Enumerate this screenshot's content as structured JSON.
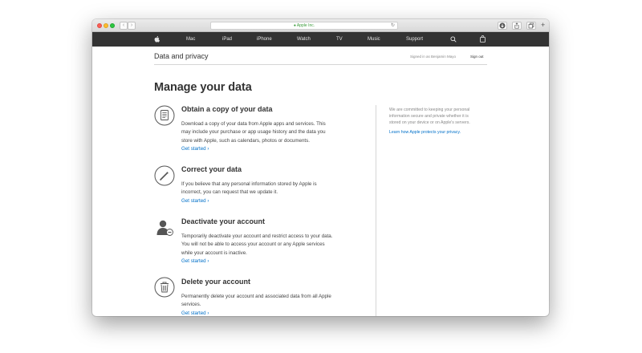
{
  "browser": {
    "url_label": "Apple Inc.",
    "back_glyph": "‹",
    "forward_glyph": "›",
    "reload_glyph": "↻",
    "new_tab_glyph": "+",
    "traffic_light_colors": {
      "close": "#fc5f57",
      "minimize": "#fdbc2e",
      "zoom": "#2bc840"
    }
  },
  "global_nav": {
    "icons": {
      "logo": "apple-logo-icon",
      "search": "search-icon",
      "bag": "shopping-bag-icon"
    },
    "items": [
      "Mac",
      "iPad",
      "iPhone",
      "Watch",
      "TV",
      "Music",
      "Support"
    ],
    "background": "#333333"
  },
  "local_nav": {
    "title": "Data and privacy",
    "signed_in": "Signed in as Benjamin Mayo",
    "sign_out": "Sign out"
  },
  "main": {
    "heading": "Manage your data",
    "items": [
      {
        "icon": "document-icon",
        "title": "Obtain a copy of your data",
        "lines": [
          "Download a copy of your data from Apple apps and services. This",
          "may include your purchase or app usage history and the data you",
          "store with Apple, such as calendars, photos or documents."
        ],
        "link": "Get started ›"
      },
      {
        "icon": "pencil-icon",
        "title": "Correct your data",
        "lines": [
          "If you believe that any personal information stored by Apple is",
          "incorrect, you can request that we update it."
        ],
        "link": "Get started ›"
      },
      {
        "icon": "user-deactivate-icon",
        "title": "Deactivate your account",
        "lines": [
          "Temporarily deactivate your account and restrict access to your data.",
          "You will not be able to access your account or any Apple services",
          "while your account is inactive."
        ],
        "link": "Get started ›"
      },
      {
        "icon": "trash-icon",
        "title": "Delete your account",
        "lines": [
          "Permanently delete your account and associated data from all Apple",
          "services."
        ],
        "link": "Get started ›"
      }
    ]
  },
  "sidebar": {
    "lines": [
      "We are committed to keeping your personal",
      "information secure and private whether it is",
      "stored on your device or on Apple's servers."
    ],
    "link": "Learn how Apple protects your privacy."
  },
  "colors": {
    "link": "#0070c9",
    "text": "#333333",
    "muted": "#888888"
  }
}
